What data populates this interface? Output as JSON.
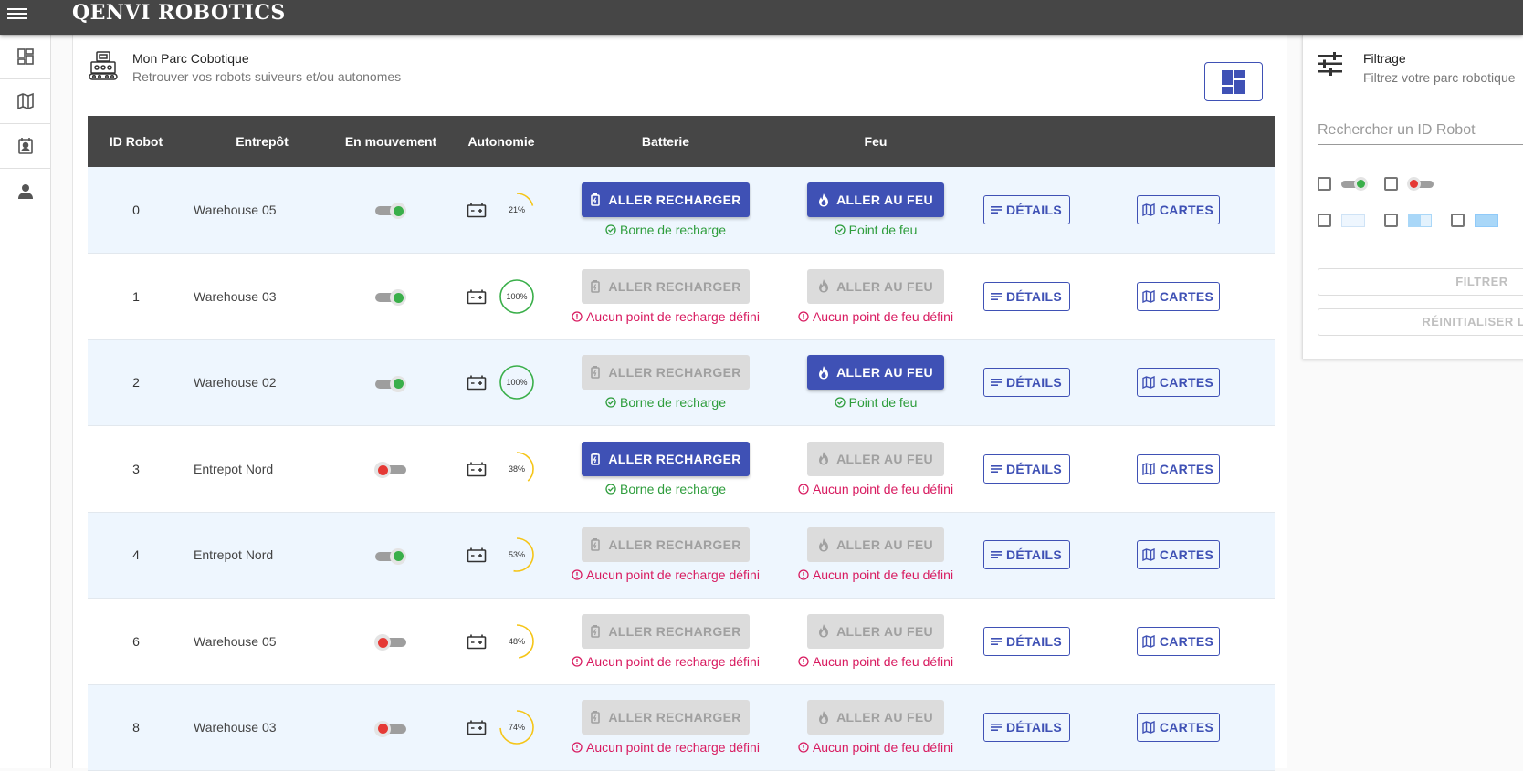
{
  "app": {
    "brand": "QENVI ROBOTICS"
  },
  "nav": {
    "items": [
      {
        "icon": "dashboard-icon"
      },
      {
        "icon": "map-icon"
      },
      {
        "icon": "contacts-icon"
      },
      {
        "icon": "person-icon"
      }
    ]
  },
  "header": {
    "title": "Mon Parc Cobotique",
    "subtitle": "Retrouver vos robots suiveurs et/ou autonomes"
  },
  "table": {
    "columns": [
      "ID Robot",
      "Entrepôt",
      "En mouvement",
      "Autonomie",
      "Batterie",
      "Feu"
    ],
    "recharge_label": "ALLER RECHARGER",
    "fire_label": "ALLER AU FEU",
    "details_label": "DÉTAILS",
    "maps_label": "CARTES",
    "rows": [
      {
        "id": "0",
        "warehouse": "Warehouse 05",
        "moving": true,
        "autonomy": 21,
        "autonomy_label": "21%",
        "recharge_enabled": true,
        "recharge_status": "Borne de recharge",
        "recharge_ok": true,
        "fire_enabled": true,
        "fire_status": "Point de feu",
        "fire_ok": true
      },
      {
        "id": "1",
        "warehouse": "Warehouse 03",
        "moving": true,
        "autonomy": 100,
        "autonomy_label": "100%",
        "recharge_enabled": false,
        "recharge_status": "Aucun point de recharge défini",
        "recharge_ok": false,
        "fire_enabled": false,
        "fire_status": "Aucun point de feu défini",
        "fire_ok": false
      },
      {
        "id": "2",
        "warehouse": "Warehouse 02",
        "moving": true,
        "autonomy": 100,
        "autonomy_label": "100%",
        "recharge_enabled": false,
        "recharge_status": "Borne de recharge",
        "recharge_ok": true,
        "fire_enabled": true,
        "fire_status": "Point de feu",
        "fire_ok": true
      },
      {
        "id": "3",
        "warehouse": "Entrepot Nord",
        "moving": false,
        "autonomy": 38,
        "autonomy_label": "38%",
        "recharge_enabled": true,
        "recharge_status": "Borne de recharge",
        "recharge_ok": true,
        "fire_enabled": false,
        "fire_status": "Aucun point de feu défini",
        "fire_ok": false
      },
      {
        "id": "4",
        "warehouse": "Entrepot Nord",
        "moving": true,
        "autonomy": 53,
        "autonomy_label": "53%",
        "recharge_enabled": false,
        "recharge_status": "Aucun point de recharge défini",
        "recharge_ok": false,
        "fire_enabled": false,
        "fire_status": "Aucun point de feu défini",
        "fire_ok": false
      },
      {
        "id": "6",
        "warehouse": "Warehouse 05",
        "moving": false,
        "autonomy": 48,
        "autonomy_label": "48%",
        "recharge_enabled": false,
        "recharge_status": "Aucun point de recharge défini",
        "recharge_ok": false,
        "fire_enabled": false,
        "fire_status": "Aucun point de feu défini",
        "fire_ok": false
      },
      {
        "id": "8",
        "warehouse": "Warehouse 03",
        "moving": false,
        "autonomy": 74,
        "autonomy_label": "74%",
        "recharge_enabled": false,
        "recharge_status": "Aucun point de recharge défini",
        "recharge_ok": false,
        "fire_enabled": false,
        "fire_status": "Aucun point de feu défini",
        "fire_ok": false
      }
    ]
  },
  "filter": {
    "title": "Filtrage",
    "subtitle": "Filtrez votre parc robotique",
    "search_placeholder": "Rechercher un ID Robot",
    "filter_button": "FILTRER",
    "reset_button": "RÉINITIALISER LES"
  },
  "colors": {
    "primary": "#3f51b5",
    "topbar": "#464646",
    "ok": "#2e9d3c",
    "error": "#d81b60",
    "gauge_full": "#3aaf4a",
    "gauge_partial": "#f5c518"
  }
}
